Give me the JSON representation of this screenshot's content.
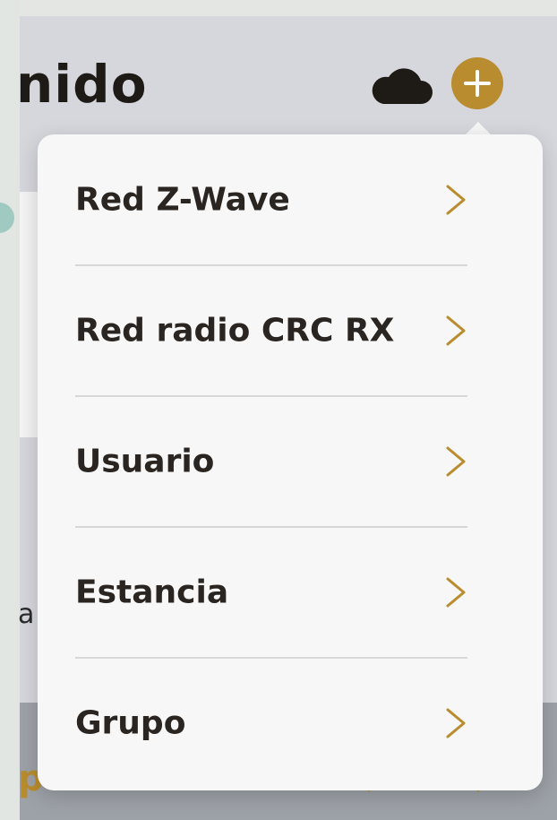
{
  "header": {
    "title_fragment": "nido",
    "cloud_icon": "cloud-icon",
    "add_icon": "plus-icon"
  },
  "background": {
    "text_fragment": "a",
    "bottom_fragment": "p"
  },
  "menu": {
    "items": [
      {
        "label": "Red Z-Wave",
        "icon": "chevron-right-icon"
      },
      {
        "label": "Red radio CRC RX",
        "icon": "chevron-right-icon"
      },
      {
        "label": "Usuario",
        "icon": "chevron-right-icon"
      },
      {
        "label": "Estancia",
        "icon": "chevron-right-icon"
      },
      {
        "label": "Grupo",
        "icon": "chevron-right-icon"
      }
    ]
  },
  "colors": {
    "accent": "#b98d2f",
    "header_bg": "#d6d7dd",
    "menu_bg": "#f7f7f7",
    "text_dark": "#1e1a15",
    "divider": "#d7d7d7"
  }
}
